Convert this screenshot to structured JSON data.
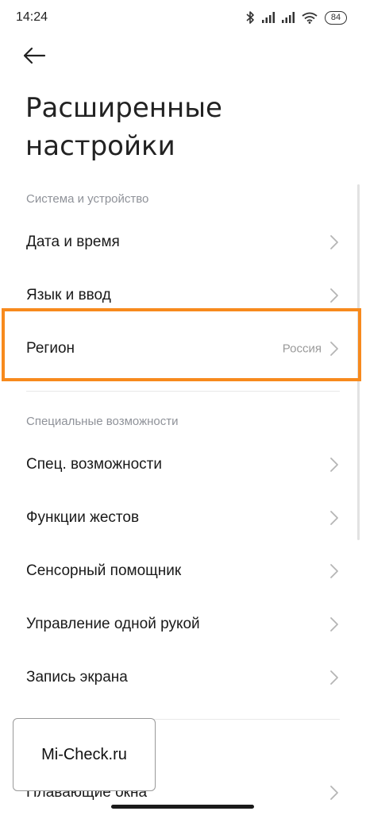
{
  "status_bar": {
    "time": "14:24",
    "battery": "84",
    "icons": [
      "bluetooth-icon",
      "signal-icon",
      "signal-icon",
      "wifi-icon",
      "battery-icon"
    ]
  },
  "header": {
    "back_icon": "arrow-left-icon",
    "title": "Расширенные настройки"
  },
  "sections": {
    "system": {
      "header": "Система и устройство",
      "items": [
        {
          "label": "Дата и время"
        },
        {
          "label": "Язык и ввод"
        },
        {
          "label": "Регион",
          "value": "Россия"
        }
      ]
    },
    "accessibility": {
      "header": "Специальные возможности",
      "items": [
        {
          "label": "Спец. возможности"
        },
        {
          "label": "Функции жестов"
        },
        {
          "label": "Сенсорный помощник"
        },
        {
          "label": "Управление одной рукой"
        },
        {
          "label": "Запись экрана"
        }
      ]
    },
    "partial": {
      "items": [
        {
          "label": "Плавающие окна"
        }
      ]
    }
  },
  "watermark": "Mi-Check.ru",
  "colors": {
    "highlight": "#f78a1d",
    "section_header": "#8f9299",
    "value_text": "#9a9a9a"
  }
}
